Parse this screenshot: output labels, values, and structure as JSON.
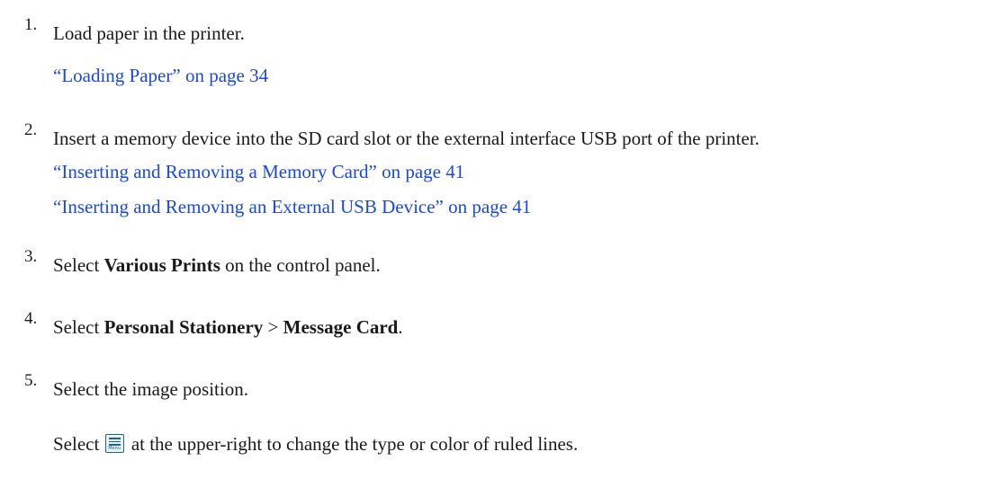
{
  "steps": [
    {
      "number": "1.",
      "text": "Load paper in the printer.",
      "links": [
        "“Loading Paper” on page 34"
      ]
    },
    {
      "number": "2.",
      "text": "Insert a memory device into the SD card slot or the external interface USB port of the printer.",
      "links": [
        "“Inserting and Removing a Memory Card” on page 41",
        "“Inserting and Removing an External USB Device” on page 41"
      ]
    },
    {
      "number": "3.",
      "prefix": "Select ",
      "bold": "Various Prints",
      "suffix": " on the control panel."
    },
    {
      "number": "4.",
      "prefix": "Select ",
      "bold1": "Personal Stationery",
      "separator": " > ",
      "bold2": "Message Card",
      "suffix": "."
    },
    {
      "number": "5.",
      "text": "Select the image position.",
      "note_prefix": "Select",
      "note_suffix": "at the upper-right to change the type or color of ruled lines.",
      "icon": {
        "name": "menu-icon",
        "caption": "Menu"
      }
    }
  ]
}
